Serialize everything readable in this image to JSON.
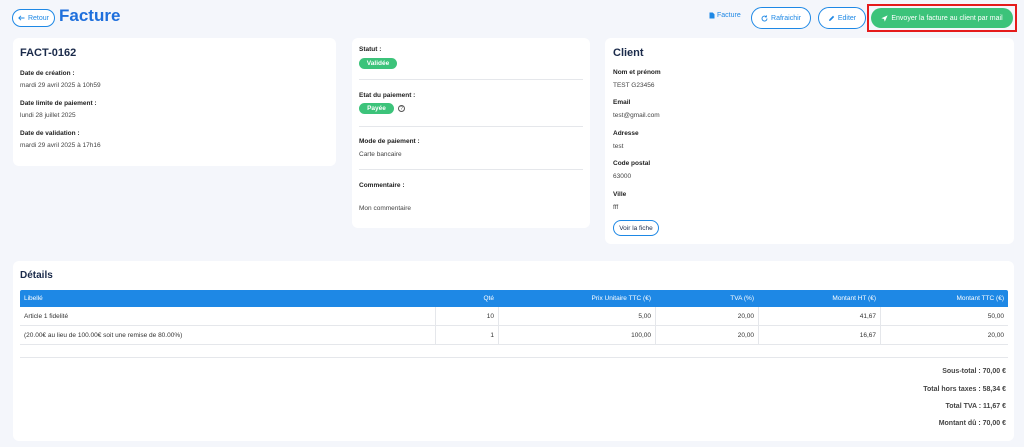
{
  "header": {
    "back_label": "Retour",
    "title": "Facture",
    "facture_link": "Facture",
    "refresh_label": "Rafraichir",
    "edit_label": "Editer",
    "send_label": "Envoyer la facture au client par mail"
  },
  "invoice": {
    "number": "FACT-0162",
    "created_label": "Date de création :",
    "created_value": "mardi 29 avril 2025 à 10h59",
    "due_label": "Date limite de paiement :",
    "due_value": "lundi 28 juillet 2025",
    "validated_label": "Date de validation :",
    "validated_value": "mardi 29 avril 2025 à 17h16"
  },
  "status": {
    "status_label": "Statut :",
    "status_value": "Validée",
    "payment_state_label": "Etat du paiement :",
    "payment_state_value": "Payée",
    "payment_mode_label": "Mode de paiement :",
    "payment_mode_value": "Carte bancaire",
    "comment_label": "Commentaire :",
    "comment_value": "Mon commentaire"
  },
  "client": {
    "title": "Client",
    "name_label": "Nom et prénom",
    "name_value": "TEST G23456",
    "email_label": "Email",
    "email_value": "test@gmail.com",
    "address_label": "Adresse",
    "address_value": "test",
    "postal_label": "Code postal",
    "postal_value": "63000",
    "city_label": "Ville",
    "city_value": "fff",
    "view_label": "Voir la fiche"
  },
  "details": {
    "title": "Détails",
    "columns": [
      "Libellé",
      "Qté",
      "Prix Unitaire TTC (€)",
      "TVA (%)",
      "Montant HT (€)",
      "Montant TTC (€)"
    ],
    "rows": [
      [
        "Article 1 fidelité",
        "10",
        "5,00",
        "20,00",
        "41,67",
        "50,00"
      ],
      [
        "(20.00€ au lieu de 100.00€ soit une remise de 80.00%)",
        "1",
        "100,00",
        "20,00",
        "16,67",
        "20,00"
      ]
    ],
    "subtotal": "Sous-total : 70,00 €",
    "total_ht": "Total hors taxes : 58,34 €",
    "total_tva": "Total TVA : 11,67 €",
    "amount_due": "Montant dû : 70,00 €"
  },
  "colors": {
    "accent": "#1e88e5",
    "success": "#3cc37a",
    "highlight": "#e51b1b"
  }
}
